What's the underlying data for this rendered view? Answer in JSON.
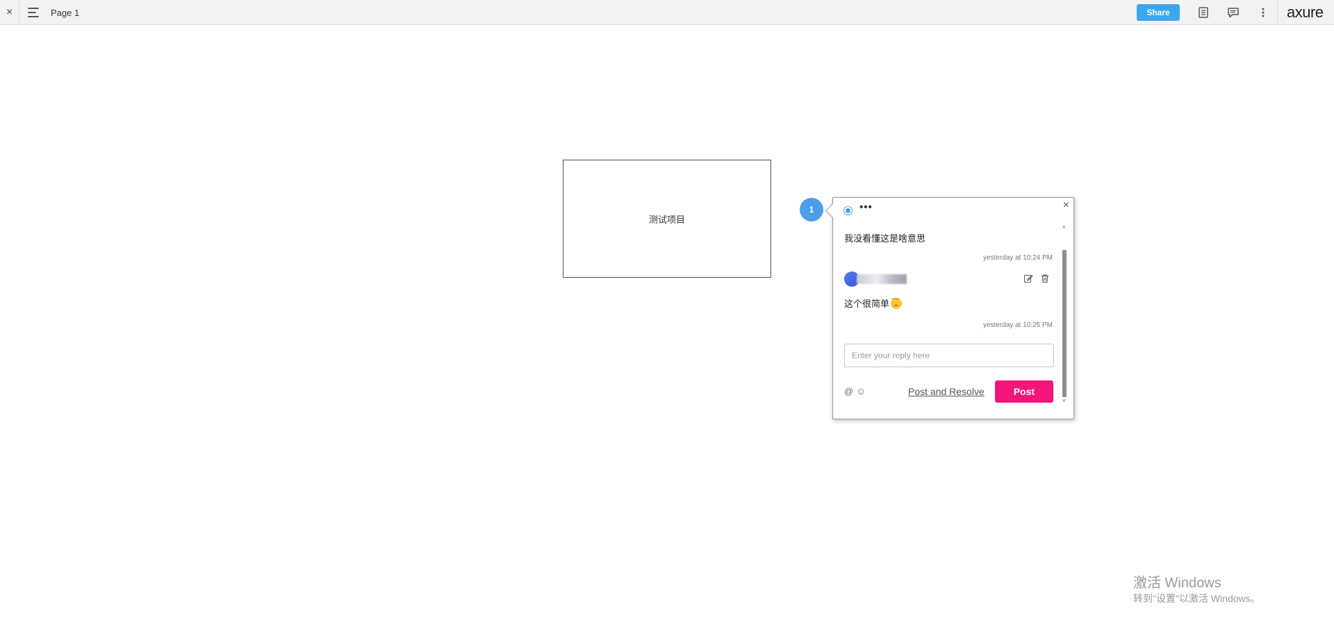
{
  "topbar": {
    "close_glyph": "×",
    "page_title": "Page 1",
    "share_label": "Share",
    "logo_text": "axure",
    "icons": [
      "menu-icon",
      "page-notes-icon",
      "comments-icon",
      "more-vertical-icon"
    ]
  },
  "canvas": {
    "widget_label": "测试项目"
  },
  "comment": {
    "pin_number": "1",
    "dots": "•••",
    "close_glyph": "×",
    "text": "我没看懂这是啥意思",
    "timestamp": "yesterday at 10:24 PM",
    "reply_text": "这个很简单",
    "reply_timestamp": "yesterday at 10:25 PM",
    "input_placeholder": "Enter your reply here",
    "at_glyph": "@",
    "emoji_glyph": "☺",
    "resolve_label": "Post and Resolve",
    "post_label": "Post",
    "scroll_up": "˄",
    "scroll_down": "˅"
  },
  "watermark": {
    "title": "激活 Windows",
    "subtitle": "转到\"设置\"以激活 Windows。"
  },
  "colors": {
    "share": "#3aa7f0",
    "pin": "#4a9fe9",
    "post": "#f3157a"
  }
}
